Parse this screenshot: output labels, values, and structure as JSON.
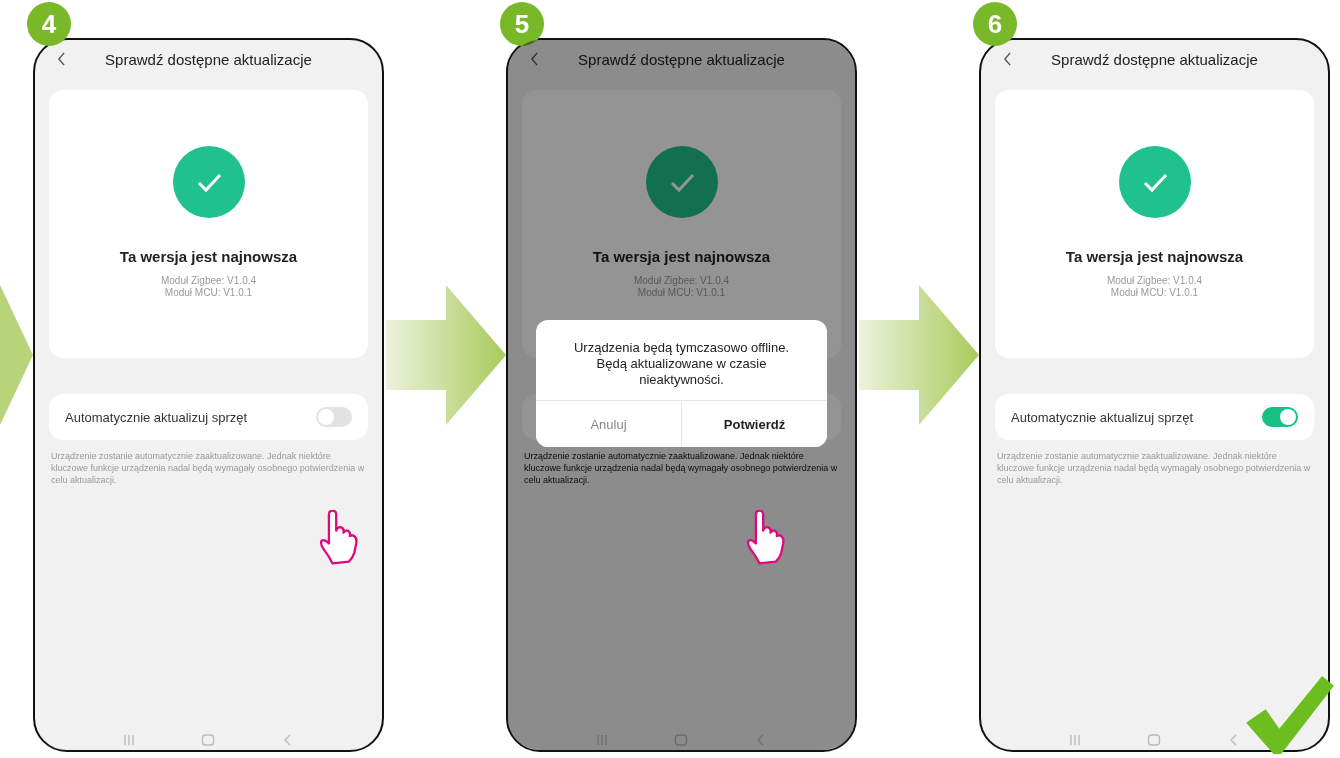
{
  "panels": [
    {
      "step": "4",
      "title": "Sprawdź dostępne aktualizacje",
      "status": "Ta wersja jest najnowsza",
      "versions": [
        "Moduł Zigbee: V1.0.4",
        "Moduł MCU: V1.0.1"
      ],
      "setting": {
        "label": "Automatycznie aktualizuj sprzęt",
        "on": false
      },
      "description": "Urządzenie zostanie automatycznie zaaktualizowane. Jednak niektóre kluczowe funkcje urządzenia nadal będą wymagały osobnego potwierdzenia w celu aktualizacji.",
      "tapped": true,
      "completed": false
    },
    {
      "step": "5",
      "title": "Sprawdź dostępne aktualizacje",
      "status": "Ta wersja jest najnowsza",
      "versions": [
        "Moduł Zigbee: V1.0.4",
        "Moduł MCU: V1.0.1"
      ],
      "description": "Urządzenie zostanie automatycznie zaaktualizowane. Jednak niektóre kluczowe funkcje urządzenia nadal będą wymagały osobnego potwierdzenia w celu aktualizacji.",
      "dialog": {
        "message": "Urządzenia będą tymczasowo offline. Będą aktualizowane w czasie nieaktywności.",
        "buttons": [
          {
            "label": "Anuluj",
            "kind": "cancel"
          },
          {
            "label": "Potwierdź",
            "kind": "confirm"
          }
        ]
      },
      "tapped": true,
      "completed": false
    },
    {
      "step": "6",
      "title": "Sprawdź dostępne aktualizacje",
      "status": "Ta wersja jest najnowsza",
      "versions": [
        "Moduł Zigbee: V1.0.4",
        "Moduł MCU: V1.0.1"
      ],
      "setting": {
        "label": "Automatycznie aktualizuj sprzęt",
        "on": true
      },
      "description": "Urządzenie zostanie automatycznie zaaktualizowane. Jednak niektóre kluczowe funkcje urządzenia nadal będą wymagały osobnego potwierdzenia w celu aktualizacji.",
      "tapped": false,
      "completed": true
    }
  ]
}
